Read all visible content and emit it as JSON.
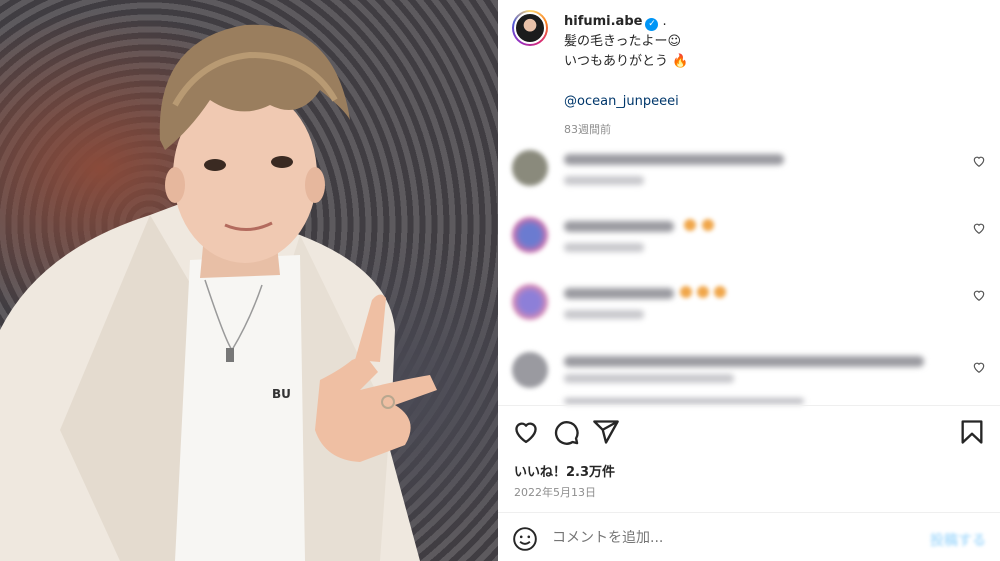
{
  "post": {
    "username": "hifumi.abe",
    "separator": ".",
    "caption_line1": "髪の毛きったよー☺",
    "caption_line2": "いつもありがとう 🔥",
    "mention": "@ocean_junpeeei",
    "time_ago": "83週間前"
  },
  "comments": [
    {
      "avatar_color": "#8a8a7c"
    },
    {
      "avatar_color": "#6b7bd0"
    },
    {
      "avatar_color": "#8d7fd8"
    },
    {
      "avatar_color": "#9a9aa0"
    }
  ],
  "engagement": {
    "likes": "いいね！2.3万件",
    "date": "2022年5月13日"
  },
  "comment_box": {
    "placeholder": "コメントを追加...",
    "post_label": "投稿する"
  },
  "icons": {
    "like": "heart-icon",
    "comment": "comment-icon",
    "share": "share-icon",
    "save": "bookmark-icon",
    "emoji": "emoji-icon"
  },
  "colors": {
    "verified": "#0095f6",
    "mention": "#00376b",
    "muted": "#8e8e8e"
  }
}
